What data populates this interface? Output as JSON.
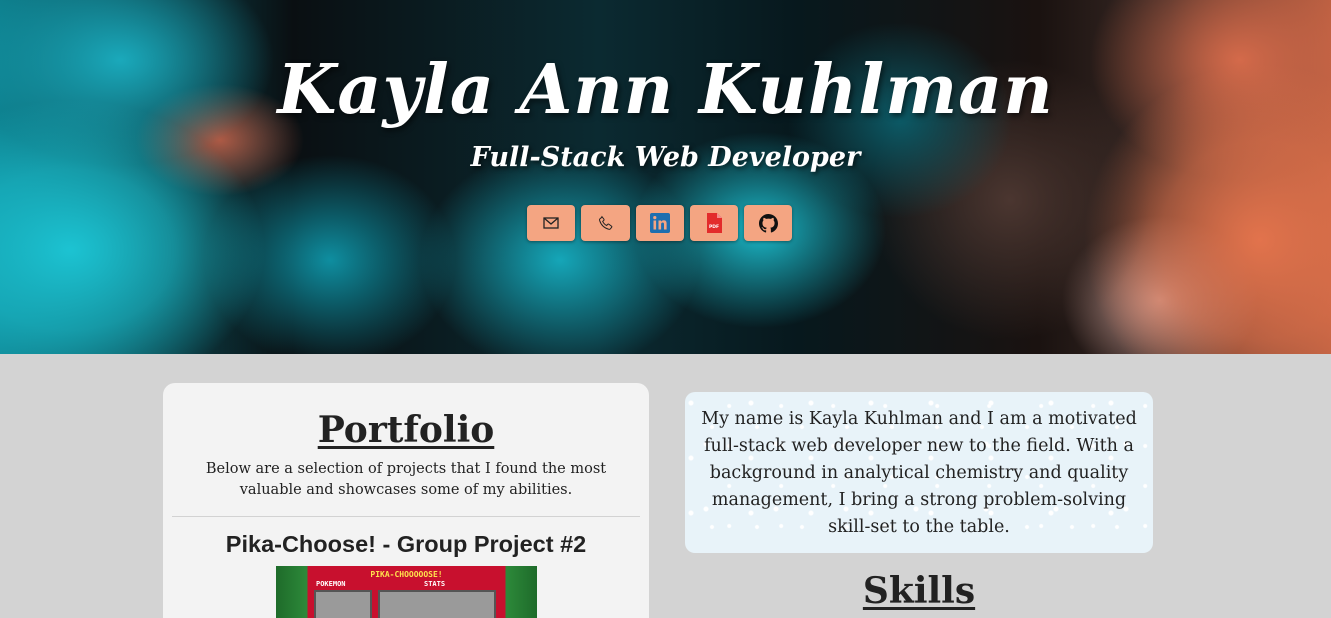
{
  "hero": {
    "name": "Kayla Ann Kuhlman",
    "tagline": "Full-Stack Web Developer",
    "contact_buttons": [
      {
        "icon": "envelope-icon"
      },
      {
        "icon": "phone-icon"
      },
      {
        "icon": "linkedin-icon"
      },
      {
        "icon": "pdf-icon",
        "icon_text": "PDF"
      },
      {
        "icon": "github-icon"
      }
    ]
  },
  "portfolio": {
    "title": "Portfolio",
    "description": "Below are a selection of projects that I found the most valuable and showcases some of my abilities.",
    "projects": [
      {
        "title": "Pika-Choose! - Group Project #2",
        "thumbnail": {
          "heading": "PIKA-CHOOOOOSE!",
          "left_label": "POKEMON",
          "right_label": "STATS"
        }
      }
    ]
  },
  "about": {
    "text": "My name is Kayla Kuhlman and I am a motivated full-stack web developer new to the field. With a background in analytical chemistry and quality management, I bring a strong problem-solving skill-set to the table."
  },
  "skills": {
    "title": "Skills"
  },
  "colors": {
    "page_background": "#d3d3d3",
    "button_accent": "#f4a582",
    "card_background": "#f3f3f3",
    "about_background": "#e8f3f9"
  }
}
